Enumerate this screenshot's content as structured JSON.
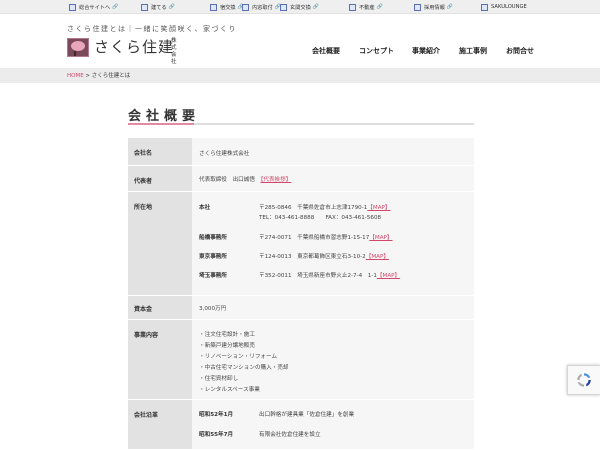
{
  "topbar": {
    "items": [
      {
        "label": "総合サイトへ",
        "ext": "🔗"
      },
      {
        "label": "建てる",
        "ext": "🔗"
      },
      {
        "label": "宿交換",
        "ext": "🔗"
      },
      {
        "label": "内窓取付",
        "ext": "🔗"
      },
      {
        "label": "玄関交換",
        "ext": "🔗"
      },
      {
        "label": "不動産",
        "ext": "🔗"
      },
      {
        "label": "採用情報",
        "ext": "🔗"
      },
      {
        "label": "SAKULOUNGE",
        "ext": ""
      }
    ]
  },
  "header": {
    "tagline": "さくら住建とは｜一緒に笑顔咲く、家づくり",
    "logo_text": "さくら住建",
    "logo_kaisha": "株式会社",
    "nav": [
      "会社概要",
      "コンセプト",
      "事業紹介",
      "施工事例",
      "お問合せ"
    ]
  },
  "breadcrumb": {
    "home": "HOME",
    "sep": " > ",
    "current": "さくら住建とは"
  },
  "section_title": "会社概要",
  "company": {
    "name_label": "会社名",
    "name_value": "さくら住建株式会社",
    "rep_label": "代表者",
    "rep_value": "代表取締役　出口誠悟",
    "rep_link": "【代表挨拶】",
    "loc_label": "所在地",
    "locations": [
      {
        "name": "本社",
        "line1": "〒285-0846　千葉県佐倉市上志津1790-1",
        "map": "【MAP】",
        "line2": "TEL：043-461-8888　　FAX：043-461-5608"
      },
      {
        "name": "船橋事務所",
        "line1": "〒274-0071　千葉県船橋市習志野1-15-17",
        "map": "【MAP】"
      },
      {
        "name": "東京事務所",
        "line1": "〒124-0013　東京都葛飾区東立石3-10-2",
        "map": "【MAP】"
      },
      {
        "name": "埼玉事務所",
        "line1": "〒352-0011　埼玉県新座市野火止2-7-4　1-1",
        "map": "【MAP】"
      }
    ],
    "capital_label": "資本金",
    "capital_value": "3,000万円",
    "business_label": "事業内容",
    "business_items": [
      "・注文住宅設計・施工",
      "・新築戸建分譲地販売",
      "・リノベーション・リフォーム",
      "・中古住宅マンションの購入・売却",
      "・住宅資材卸し",
      "・レンタルスペース事業"
    ],
    "history_label": "会社沿革",
    "history": [
      {
        "date": "昭和52年1月",
        "text": "出口幹格が建具業「佐倉住建」を創業"
      },
      {
        "date": "昭和55年7月",
        "text": "有限会社佐倉住建を設立"
      }
    ]
  }
}
